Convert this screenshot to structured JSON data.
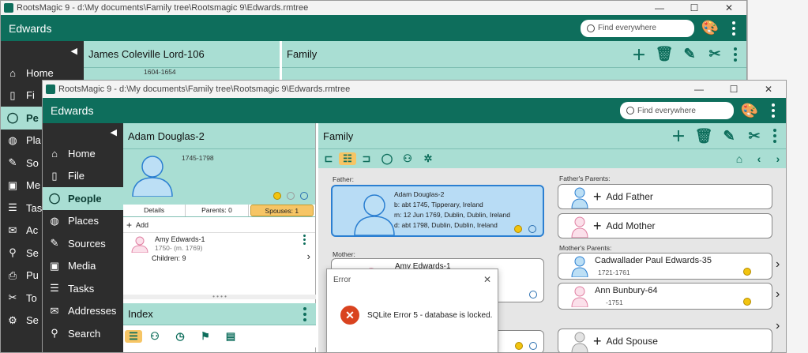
{
  "back_window": {
    "title": "RootsMagic 9 - d:\\My documents\\Family tree\\Rootsmagic 9\\Edwards.rmtree",
    "app_name": "Edwards",
    "search_placeholder": "Find everywhere",
    "person_name": "James Coleville Lord-106",
    "person_dates": "1604-1654",
    "family_label": "Family",
    "nav": [
      "Home",
      "Fi",
      "Pe",
      "Pla",
      "So",
      "Me",
      "Tas",
      "Ac",
      "Se",
      "Pu",
      "To",
      "Se"
    ]
  },
  "front_window": {
    "title": "RootsMagic 9 - d:\\My documents\\Family tree\\Rootsmagic 9\\Edwards.rmtree",
    "app_name": "Edwards",
    "search_placeholder": "Find everywhere",
    "nav": [
      "Home",
      "File",
      "People",
      "Places",
      "Sources",
      "Media",
      "Tasks",
      "Addresses",
      "Search"
    ],
    "active_nav": "People",
    "person": {
      "name": "Adam Douglas-2",
      "dates": "1745-1798",
      "tabs": [
        "Details",
        "Parents: 0",
        "Spouses: 1"
      ],
      "add_label": "Add",
      "spouse_name": "Amy Edwards-1",
      "spouse_dates": "1750- (m. 1769)",
      "children": "Children: 9"
    },
    "index_label": "Index",
    "family": {
      "label": "Family",
      "father_label": "Father:",
      "father": {
        "name": "Adam Douglas-2",
        "birth": "b: abt 1745, Tipperary, Ireland",
        "marriage": "m: 12 Jun 1769, Dublin, Dublin, Ireland",
        "death": "d: abt 1798, Dublin, Dublin, Ireland"
      },
      "mother_label": "Mother:",
      "mother_name": "Amy Edwards-1",
      "fathers_parents_label": "Father's Parents:",
      "add_father": "Add Father",
      "add_mother": "Add Mother",
      "mothers_parents_label": "Mother's Parents:",
      "mp_father": {
        "name": "Cadwallader Paul Edwards-35",
        "dates": "1721-1761"
      },
      "mp_mother": {
        "name": "Ann Bunbury-64",
        "dates": "-1751"
      },
      "add_spouse": "Add Spouse"
    }
  },
  "error_dialog": {
    "title": "Error",
    "message": "SQLite Error 5 - database is locked."
  },
  "colors": {
    "teal": "#0e6e5c",
    "mint": "#a9ded3",
    "sidebar": "#2d2d2d",
    "selected": "#b8dcf5"
  }
}
